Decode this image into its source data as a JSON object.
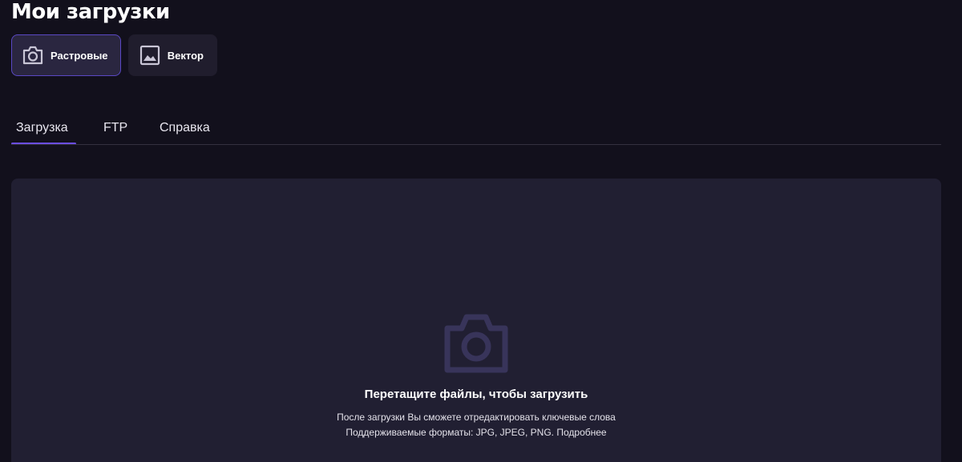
{
  "page": {
    "title": "Мои загрузки"
  },
  "type_switch": {
    "items": [
      {
        "label": "Растровые",
        "icon": "camera-icon",
        "active": true
      },
      {
        "label": "Вектор",
        "icon": "image-icon",
        "active": false
      }
    ]
  },
  "tabs": [
    {
      "label": "Загрузка",
      "active": true
    },
    {
      "label": "FTP",
      "active": false
    },
    {
      "label": "Справка",
      "active": false
    }
  ],
  "dropzone": {
    "icon": "camera-icon",
    "title": "Перетащите файлы, чтобы загрузить",
    "hint_line1": "После загрузки Вы сможете отредактировать ключевые слова",
    "formats_text": "Поддерживаемые форматы: JPG, JPEG, PNG.",
    "more_link": "Подробнее"
  },
  "colors": {
    "background": "#12101c",
    "card": "#211f32",
    "accent": "#6a4de0",
    "active_border": "#5a48c4"
  }
}
